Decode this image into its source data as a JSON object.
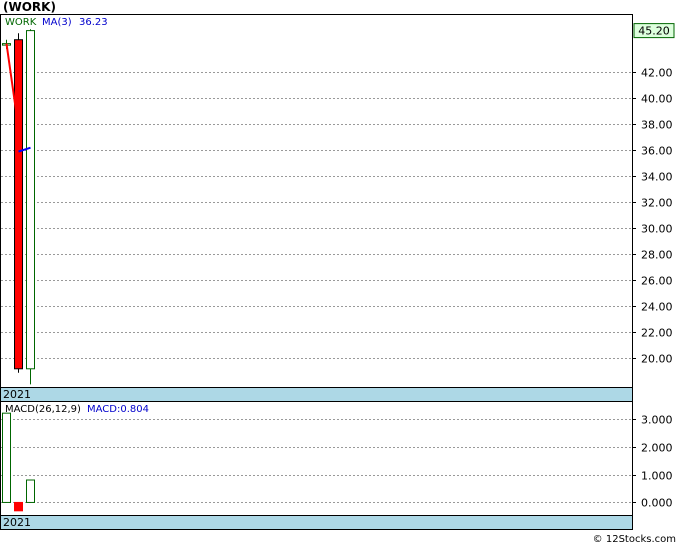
{
  "title": "(WORK)",
  "footer_credit": "© 12Stocks.com",
  "colors": {
    "background": "#ffffff",
    "grid": "#999999",
    "up_candle_border": "#006600",
    "down_candle_fill": "#ff0000",
    "ma_line": "#0000ff",
    "price_line": "#ff0000",
    "date_band": "#add8e6",
    "last_price_box_bg": "#ddffdd",
    "ticker_label": "#006600",
    "ma_label": "#0000cc"
  },
  "chart_data": [
    {
      "type": "candlestick",
      "ticker": "WORK",
      "legend": {
        "ticker_label": "WORK",
        "ma_label": "MA(3)",
        "ma_value": "36.23"
      },
      "last_price_label": "45.20",
      "x_label": "2021",
      "ylim": [
        17.8,
        46.4
      ],
      "y_ticks": [
        "42.00",
        "40.00",
        "38.00",
        "36.00",
        "34.00",
        "32.00",
        "30.00",
        "28.00",
        "26.00",
        "24.00",
        "22.00",
        "20.00"
      ],
      "y_tick_values": [
        42,
        40,
        38,
        36,
        34,
        32,
        30,
        28,
        26,
        24,
        22,
        20
      ],
      "grid": true,
      "candles": [
        {
          "open": 44.1,
          "high": 44.5,
          "low": 43.8,
          "close": 44.2,
          "direction": "up"
        },
        {
          "open": 44.5,
          "high": 45.0,
          "low": 18.9,
          "close": 19.2,
          "direction": "down"
        },
        {
          "open": 19.2,
          "high": 45.3,
          "low": 18.0,
          "close": 45.2,
          "direction": "up"
        }
      ],
      "price_line": [
        44.2,
        37.7
      ],
      "ma_line": [
        35.9,
        36.2
      ]
    },
    {
      "type": "bar",
      "indicator": "MACD",
      "legend": {
        "label": "MACD(26,12,9)",
        "value_label": "MACD:0.804"
      },
      "x_label": "2021",
      "ylim": [
        -0.45,
        3.6
      ],
      "y_ticks": [
        "3.000",
        "2.000",
        "1.000",
        "0.000"
      ],
      "y_tick_values": [
        3,
        2,
        1,
        0
      ],
      "grid": true,
      "bars": [
        {
          "value": 3.2,
          "direction": "up"
        },
        {
          "value": -0.3,
          "direction": "down"
        },
        {
          "value": 0.804,
          "direction": "up"
        }
      ]
    }
  ]
}
